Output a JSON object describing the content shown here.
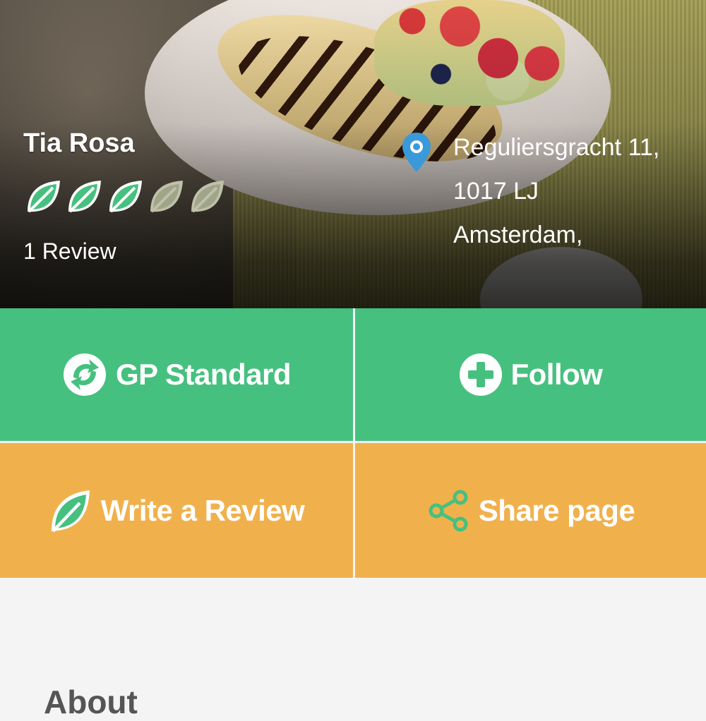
{
  "venue": {
    "name": "Tia Rosa",
    "rating": 3,
    "rating_max": 5,
    "reviews_label": "1 Review",
    "address_lines": [
      "Reguliersgracht 11,",
      "1017 LJ",
      "Amsterdam,"
    ]
  },
  "actions": {
    "gp_standard": "GP Standard",
    "follow": "Follow",
    "write_review": "Write a Review",
    "share_page": "Share page"
  },
  "section": {
    "about": "About"
  },
  "icons": {
    "leaf": "leaf-icon",
    "pin": "location-pin-icon",
    "recycle": "recycle-icon",
    "plus": "plus-circle-icon",
    "share": "share-icon"
  },
  "colors": {
    "green": "#46c07f",
    "orange": "#f0b14d",
    "leaf_dim": "#a0a58a",
    "pin_blue": "#3a9ad9"
  }
}
